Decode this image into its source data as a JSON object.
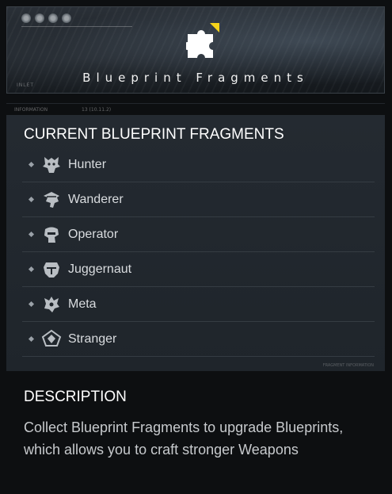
{
  "banner": {
    "title": "Blueprint Fragments",
    "tag": "INLET",
    "icon": "puzzle-piece-icon",
    "accent": "#f5d31a"
  },
  "info_strip": {
    "left": "INFORMATION",
    "right": "13 (10.11.2)"
  },
  "fragments_panel": {
    "title": "CURRENT BLUEPRINT FRAGMENTS",
    "items": [
      {
        "label": "Hunter",
        "icon": "hunter-emblem-icon"
      },
      {
        "label": "Wanderer",
        "icon": "wanderer-emblem-icon"
      },
      {
        "label": "Operator",
        "icon": "operator-emblem-icon"
      },
      {
        "label": "Juggernaut",
        "icon": "juggernaut-emblem-icon"
      },
      {
        "label": "Meta",
        "icon": "meta-emblem-icon"
      },
      {
        "label": "Stranger",
        "icon": "stranger-emblem-icon"
      }
    ],
    "footer": "FRAGMENT INFORMATION"
  },
  "description": {
    "title": "DESCRIPTION",
    "text": "Collect Blueprint Fragments to upgrade Blueprints, which allows you to craft stronger Weapons"
  }
}
